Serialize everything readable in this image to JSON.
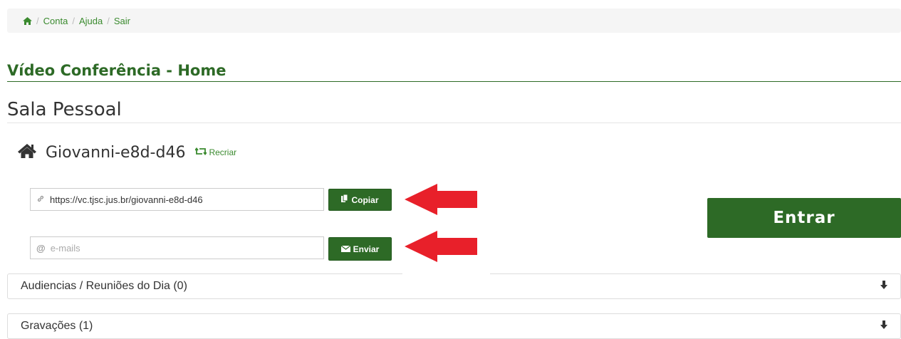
{
  "breadcrumb": {
    "items": [
      {
        "label": "Conta"
      },
      {
        "label": "Ajuda"
      },
      {
        "label": "Sair"
      }
    ],
    "separator": "/"
  },
  "page_title": "Vídeo Conferência - Home",
  "section_title": "Sala Pessoal",
  "room": {
    "name": "Giovanni-e8d-d46",
    "recreate_label": "Recriar"
  },
  "link_field": {
    "value": "https://vc.tjsc.jus.br/giovanni-e8d-d46",
    "copy_label": "Copiar"
  },
  "email_field": {
    "value": "",
    "placeholder": "e-mails",
    "send_label": "Enviar"
  },
  "enter_label": "Entrar",
  "panels": [
    {
      "label": "Audiencias / Reuniões do Dia (0)"
    },
    {
      "label": "Gravações (1)"
    }
  ],
  "colors": {
    "brand_green": "#2d6a26",
    "link_green": "#3a8a2e",
    "annotation_arrow": "#e8202a"
  },
  "icons": {
    "breadcrumb_home": "home-icon",
    "room": "house-icon",
    "recreate": "retweet-icon",
    "link": "link-icon",
    "copy": "copy-icon",
    "email": "at-icon",
    "send": "envelope-icon",
    "panel_toggle": "arrow-down-icon"
  }
}
